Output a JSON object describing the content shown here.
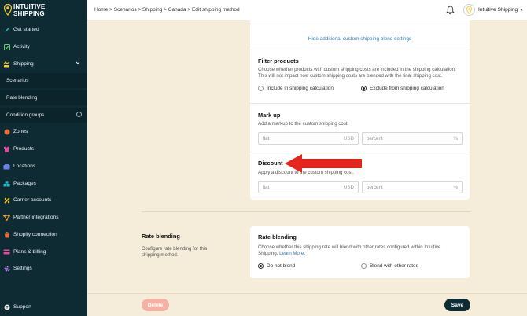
{
  "brand": {
    "line1": "INTUITIVE",
    "line2": "SHIPPING"
  },
  "sidebar": {
    "items": [
      {
        "label": "Get started",
        "icon": "rocket-icon"
      },
      {
        "label": "Activity",
        "icon": "activity-icon"
      },
      {
        "label": "Shipping",
        "icon": "shipping-icon"
      },
      {
        "label": "Scenarios"
      },
      {
        "label": "Rate blending"
      },
      {
        "label": "Condition groups"
      },
      {
        "label": "Zones",
        "icon": "zones-icon"
      },
      {
        "label": "Products",
        "icon": "products-icon"
      },
      {
        "label": "Locations",
        "icon": "locations-icon"
      },
      {
        "label": "Packages",
        "icon": "packages-icon"
      },
      {
        "label": "Carrier accounts",
        "icon": "carrier-icon"
      },
      {
        "label": "Partner integrations",
        "icon": "partner-icon"
      },
      {
        "label": "Shopify connection",
        "icon": "shopify-icon"
      },
      {
        "label": "Plans & billing",
        "icon": "billing-icon"
      },
      {
        "label": "Settings",
        "icon": "gear-icon"
      }
    ],
    "support": "Support"
  },
  "header": {
    "breadcrumb": "Home > Scenarios > Shipping > Canada > Edit shipping method",
    "account_name": "Intuitive Shipping"
  },
  "settings_card": {
    "hide_link": "Hide additional custom shipping blend settings",
    "filter": {
      "title": "Filter products",
      "desc_line1": "Choose whether products with custom shipping costs are included in the shipping calculation.",
      "desc_line2": "This will not impact how custom shipping costs are blended with the final shipping cost.",
      "opt_include": "Include in shipping calculation",
      "opt_exclude": "Exclude from shipping calculation"
    },
    "markup": {
      "title": "Mark up",
      "desc": "Add a markup to the custom shipping cost.",
      "flat_placeholder": "flat",
      "flat_unit": "USD",
      "percent_placeholder": "percent",
      "percent_unit": "%"
    },
    "discount": {
      "title": "Discount",
      "desc": "Apply a discount to the custom shipping cost.",
      "flat_placeholder": "flat",
      "flat_unit": "USD",
      "percent_placeholder": "percent",
      "percent_unit": "%"
    }
  },
  "rate_blending": {
    "side_title": "Rate blending",
    "side_desc_line1": "Configure rate blending for this",
    "side_desc_line2": "shipping method.",
    "card_title": "Rate blending",
    "desc_line1": "Choose whether this shipping rate will blend with other rates configured within Intuitive",
    "desc_line2_prefix": "Shipping.",
    "learn_more": "Learn More.",
    "opt_do_not_blend": "Do not blend",
    "opt_blend": "Blend with other rates"
  },
  "footer": {
    "delete_label": "Delete",
    "save_label": "Save"
  },
  "colors": {
    "sidebar_bg": "#0e2a33",
    "page_bg": "#f5ecd9",
    "arrow": "#e5261e",
    "link": "#2b79b6",
    "delete": "#f3b2a5"
  }
}
